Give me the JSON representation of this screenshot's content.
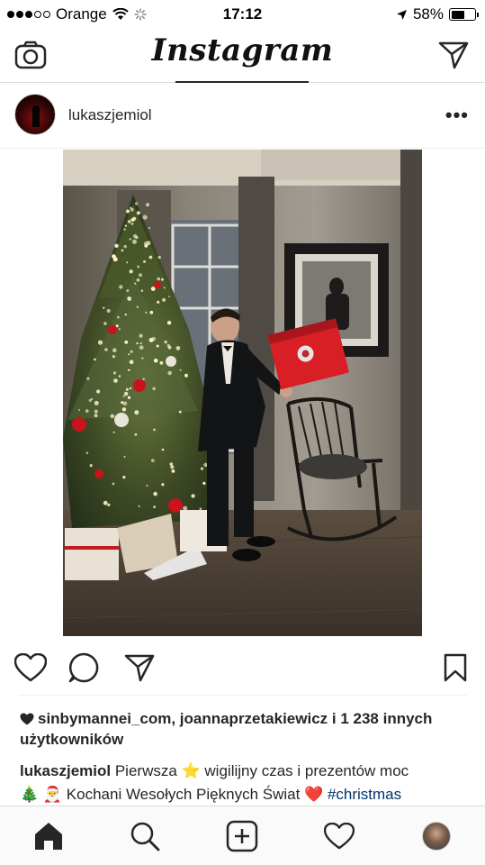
{
  "status_bar": {
    "carrier": "Orange",
    "time": "17:12",
    "battery_percent": "58%",
    "battery_level": 0.58
  },
  "header": {
    "app_title": "Instagram",
    "camera_icon": "camera-icon",
    "direct_icon": "paper-plane-icon"
  },
  "post": {
    "username": "lukaszjemiol",
    "more_label": "•••",
    "photo_icon": "photo",
    "likes_text": "sinbymannei_com, joannaprzetakiewicz i 1 238 innych użytkowników",
    "caption_user": "lukaszjemiol",
    "caption_text_1": " Pierwsza ⭐ wigilijny czas i prezentów moc",
    "caption_text_2": "🎄 🎅 Kochani Wesołych Pięknych Świat ❤️ ",
    "caption_hashtag": "#christmas"
  },
  "colors": {
    "text": "#262626",
    "divider": "#dbdbdb",
    "hashtag": "#003569",
    "gift_red": "#d81f26"
  }
}
